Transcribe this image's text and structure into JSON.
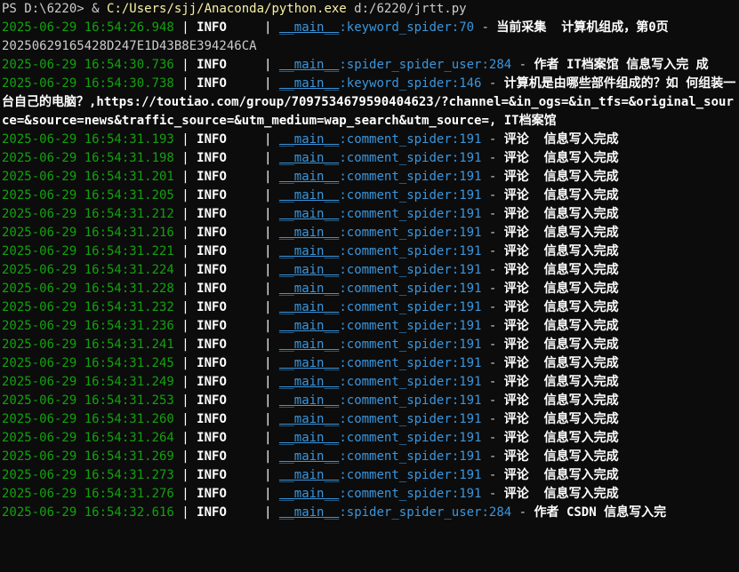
{
  "prompt": {
    "ps": "PS D:\\6220> & ",
    "exe": "C:/Users/sjj/Anaconda/python.exe",
    "arg": " d:/6220/jrtt.py"
  },
  "lines": [
    {
      "ts": "2025-06-29 16:54:26.948",
      "level": "INFO",
      "module": "__main__",
      "func": ":keyword_spider:70",
      "msg": "当前采集  计算机组成，第0页"
    },
    {
      "plain": "20250629165428D247E1D43B8E394246CA"
    },
    {
      "ts": "2025-06-29 16:54:30.736",
      "level": "INFO",
      "module": "__main__",
      "func": ":spider_spider_user:284",
      "msg": "作者 IT档案馆 信息写入完 成"
    },
    {
      "ts": "2025-06-29 16:54:30.738",
      "level": "INFO",
      "module": "__main__",
      "func": ":keyword_spider:146",
      "msg": "计算机是由哪些部件组成的？如 何组装一台自己的电脑？,https://toutiao.com/group/7097534679590404623/?channel=&in_ogs=&in_tfs=&original_source=&source=news&traffic_source=&utm_medium=wap_search&utm_source=, IT档案馆"
    },
    {
      "ts": "2025-06-29 16:54:31.193",
      "level": "INFO",
      "module": "__main__",
      "func": ":comment_spider:191",
      "msg": "评论  信息写入完成"
    },
    {
      "ts": "2025-06-29 16:54:31.198",
      "level": "INFO",
      "module": "__main__",
      "func": ":comment_spider:191",
      "msg": "评论  信息写入完成"
    },
    {
      "ts": "2025-06-29 16:54:31.201",
      "level": "INFO",
      "module": "__main__",
      "func": ":comment_spider:191",
      "msg": "评论  信息写入完成"
    },
    {
      "ts": "2025-06-29 16:54:31.205",
      "level": "INFO",
      "module": "__main__",
      "func": ":comment_spider:191",
      "msg": "评论  信息写入完成"
    },
    {
      "ts": "2025-06-29 16:54:31.212",
      "level": "INFO",
      "module": "__main__",
      "func": ":comment_spider:191",
      "msg": "评论  信息写入完成"
    },
    {
      "ts": "2025-06-29 16:54:31.216",
      "level": "INFO",
      "module": "__main__",
      "func": ":comment_spider:191",
      "msg": "评论  信息写入完成"
    },
    {
      "ts": "2025-06-29 16:54:31.221",
      "level": "INFO",
      "module": "__main__",
      "func": ":comment_spider:191",
      "msg": "评论  信息写入完成"
    },
    {
      "ts": "2025-06-29 16:54:31.224",
      "level": "INFO",
      "module": "__main__",
      "func": ":comment_spider:191",
      "msg": "评论  信息写入完成"
    },
    {
      "ts": "2025-06-29 16:54:31.228",
      "level": "INFO",
      "module": "__main__",
      "func": ":comment_spider:191",
      "msg": "评论  信息写入完成"
    },
    {
      "ts": "2025-06-29 16:54:31.232",
      "level": "INFO",
      "module": "__main__",
      "func": ":comment_spider:191",
      "msg": "评论  信息写入完成"
    },
    {
      "ts": "2025-06-29 16:54:31.236",
      "level": "INFO",
      "module": "__main__",
      "func": ":comment_spider:191",
      "msg": "评论  信息写入完成"
    },
    {
      "ts": "2025-06-29 16:54:31.241",
      "level": "INFO",
      "module": "__main__",
      "func": ":comment_spider:191",
      "msg": "评论  信息写入完成"
    },
    {
      "ts": "2025-06-29 16:54:31.245",
      "level": "INFO",
      "module": "__main__",
      "func": ":comment_spider:191",
      "msg": "评论  信息写入完成"
    },
    {
      "ts": "2025-06-29 16:54:31.249",
      "level": "INFO",
      "module": "__main__",
      "func": ":comment_spider:191",
      "msg": "评论  信息写入完成"
    },
    {
      "ts": "2025-06-29 16:54:31.253",
      "level": "INFO",
      "module": "__main__",
      "func": ":comment_spider:191",
      "msg": "评论  信息写入完成"
    },
    {
      "ts": "2025-06-29 16:54:31.260",
      "level": "INFO",
      "module": "__main__",
      "func": ":comment_spider:191",
      "msg": "评论  信息写入完成"
    },
    {
      "ts": "2025-06-29 16:54:31.264",
      "level": "INFO",
      "module": "__main__",
      "func": ":comment_spider:191",
      "msg": "评论  信息写入完成"
    },
    {
      "ts": "2025-06-29 16:54:31.269",
      "level": "INFO",
      "module": "__main__",
      "func": ":comment_spider:191",
      "msg": "评论  信息写入完成"
    },
    {
      "ts": "2025-06-29 16:54:31.273",
      "level": "INFO",
      "module": "__main__",
      "func": ":comment_spider:191",
      "msg": "评论  信息写入完成"
    },
    {
      "ts": "2025-06-29 16:54:31.276",
      "level": "INFO",
      "module": "__main__",
      "func": ":comment_spider:191",
      "msg": "评论  信息写入完成"
    },
    {
      "ts": "2025-06-29 16:54:32.616",
      "level": "INFO",
      "module": "__main__",
      "func": ":spider_spider_user:284",
      "msg": "作者 CSDN 信息写入完"
    }
  ],
  "colors": {
    "background": "#0c0c0c",
    "timestamp": "#13a10e",
    "module": "#3a96dd",
    "path": "#f9f1a5",
    "text": "#ffffff"
  }
}
